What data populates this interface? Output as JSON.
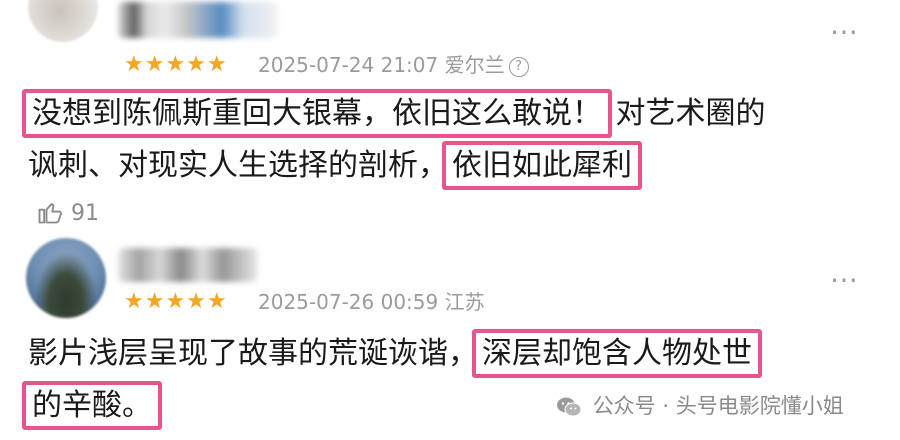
{
  "review1": {
    "date": "2025-07-24 21:07",
    "location": "爱尔兰",
    "info_glyph": "?",
    "stars": "★★★★★",
    "more_icon": "⋯",
    "text_line1_highlight": "没想到陈佩斯重回大银幕，依旧这么敢说！",
    "text_line1_rest": "对艺术圈的",
    "text_line2_plain": "讽刺、对现实人生选择的剖析，",
    "text_line2_highlight": "依旧如此犀利",
    "likes": "91"
  },
  "review2": {
    "date": "2025-07-26 00:59",
    "location": "江苏",
    "stars": "★★★★★",
    "more_icon": "⋯",
    "text_line1_plain": "影片浅层呈现了故事的荒诞诙谐，",
    "text_line1_highlight": "深层却饱含人物处世",
    "text_line2_highlight": "的辛酸。"
  },
  "watermark": "公众号 · 头号电影院懂小姐",
  "colors": {
    "star": "#f5a623",
    "highlight_border": "#e8558e",
    "meta_text": "#9b9b9b"
  }
}
